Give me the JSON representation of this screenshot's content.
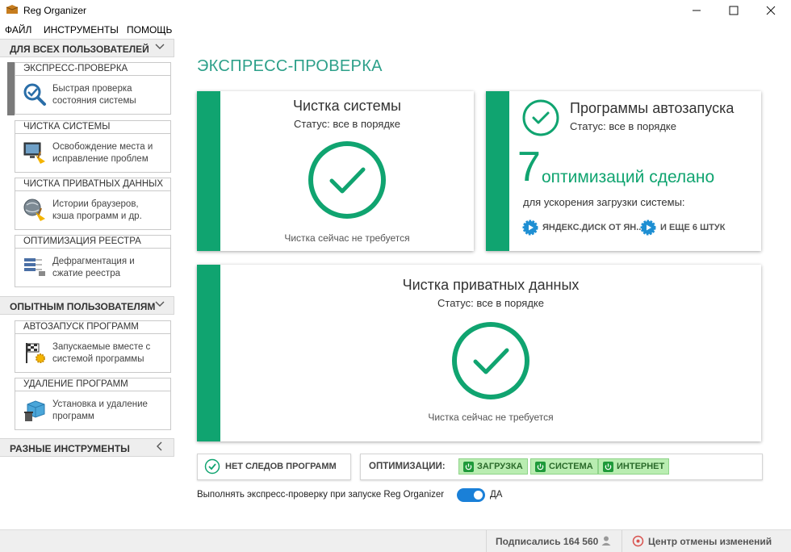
{
  "window": {
    "title": "Reg Organizer",
    "minimize": "—",
    "maximize": "☐",
    "close": "✕"
  },
  "menu": [
    "ФАЙЛ",
    "ИНСТРУМЕНТЫ",
    "ПОМОЩЬ"
  ],
  "sidebar": {
    "section_all_users": "ДЛЯ ВСЕХ ПОЛЬЗОВАТЕЛЕЙ",
    "section_advanced": "ОПЫТНЫМ ПОЛЬЗОВАТЕЛЯМ",
    "section_misc": "РАЗНЫЕ ИНСТРУМЕНТЫ",
    "items": [
      {
        "title": "ЭКСПРЕСС-ПРОВЕРКА",
        "line1": "Быстрая проверка",
        "line2": "состояния системы",
        "icon": "magnifier-check-icon"
      },
      {
        "title": "ЧИСТКА СИСТЕМЫ",
        "line1": "Освобождение места и",
        "line2": "исправление проблем",
        "icon": "monitor-broom-icon"
      },
      {
        "title": "ЧИСТКА ПРИВАТНЫХ ДАННЫХ",
        "line1": "Истории браузеров,",
        "line2": "кэша программ и др.",
        "icon": "globe-broom-icon"
      },
      {
        "title": "ОПТИМИЗАЦИЯ РЕЕСТРА",
        "line1": "Дефрагментация и",
        "line2": "сжатие реестра",
        "icon": "registry-icon"
      },
      {
        "title": "АВТОЗАПУСК ПРОГРАММ",
        "line1": "Запускаемые вместе с",
        "line2": "системой программы",
        "icon": "flag-gear-icon"
      },
      {
        "title": "УДАЛЕНИЕ ПРОГРАММ",
        "line1": "Установка и удаление",
        "line2": "программ",
        "icon": "box-trash-icon"
      }
    ]
  },
  "main": {
    "title": "ЭКСПРЕСС-ПРОВЕРКА",
    "system_card": {
      "title": "Чистка системы",
      "status": "Статус: все в порядке",
      "note": "Чистка сейчас не требуется"
    },
    "autorun_card": {
      "title": "Программы автозапуска",
      "status": "Статус: все в порядке",
      "count": "7",
      "count_label": "оптимизаций сделано",
      "subtitle": "для ускорения загрузки системы:",
      "link1": "ЯНДЕКС.ДИСК ОТ ЯН...",
      "link2": "И ЕЩЕ 6 ШТУК"
    },
    "private_card": {
      "title": "Чистка приватных данных",
      "status": "Статус: все в порядке",
      "note": "Чистка сейчас не требуется"
    },
    "no_traces": "НЕТ СЛЕДОВ ПРОГРАММ",
    "optimizations_label": "ОПТИМИЗАЦИИ:",
    "opt_buttons": [
      "ЗАГРУЗКА",
      "СИСТЕМА",
      "ИНТЕРНЕТ"
    ],
    "startup_check_label": "Выполнять экспресс-проверку при запуске Reg Organizer",
    "toggle_value": "ДА"
  },
  "statusbar": {
    "subscribed": "Подписались 164 560",
    "undo_center": "Центр отмены изменений"
  },
  "colors": {
    "accent_green": "#10a470",
    "title_teal": "#2da08a",
    "toggle_blue": "#1a80d8"
  }
}
